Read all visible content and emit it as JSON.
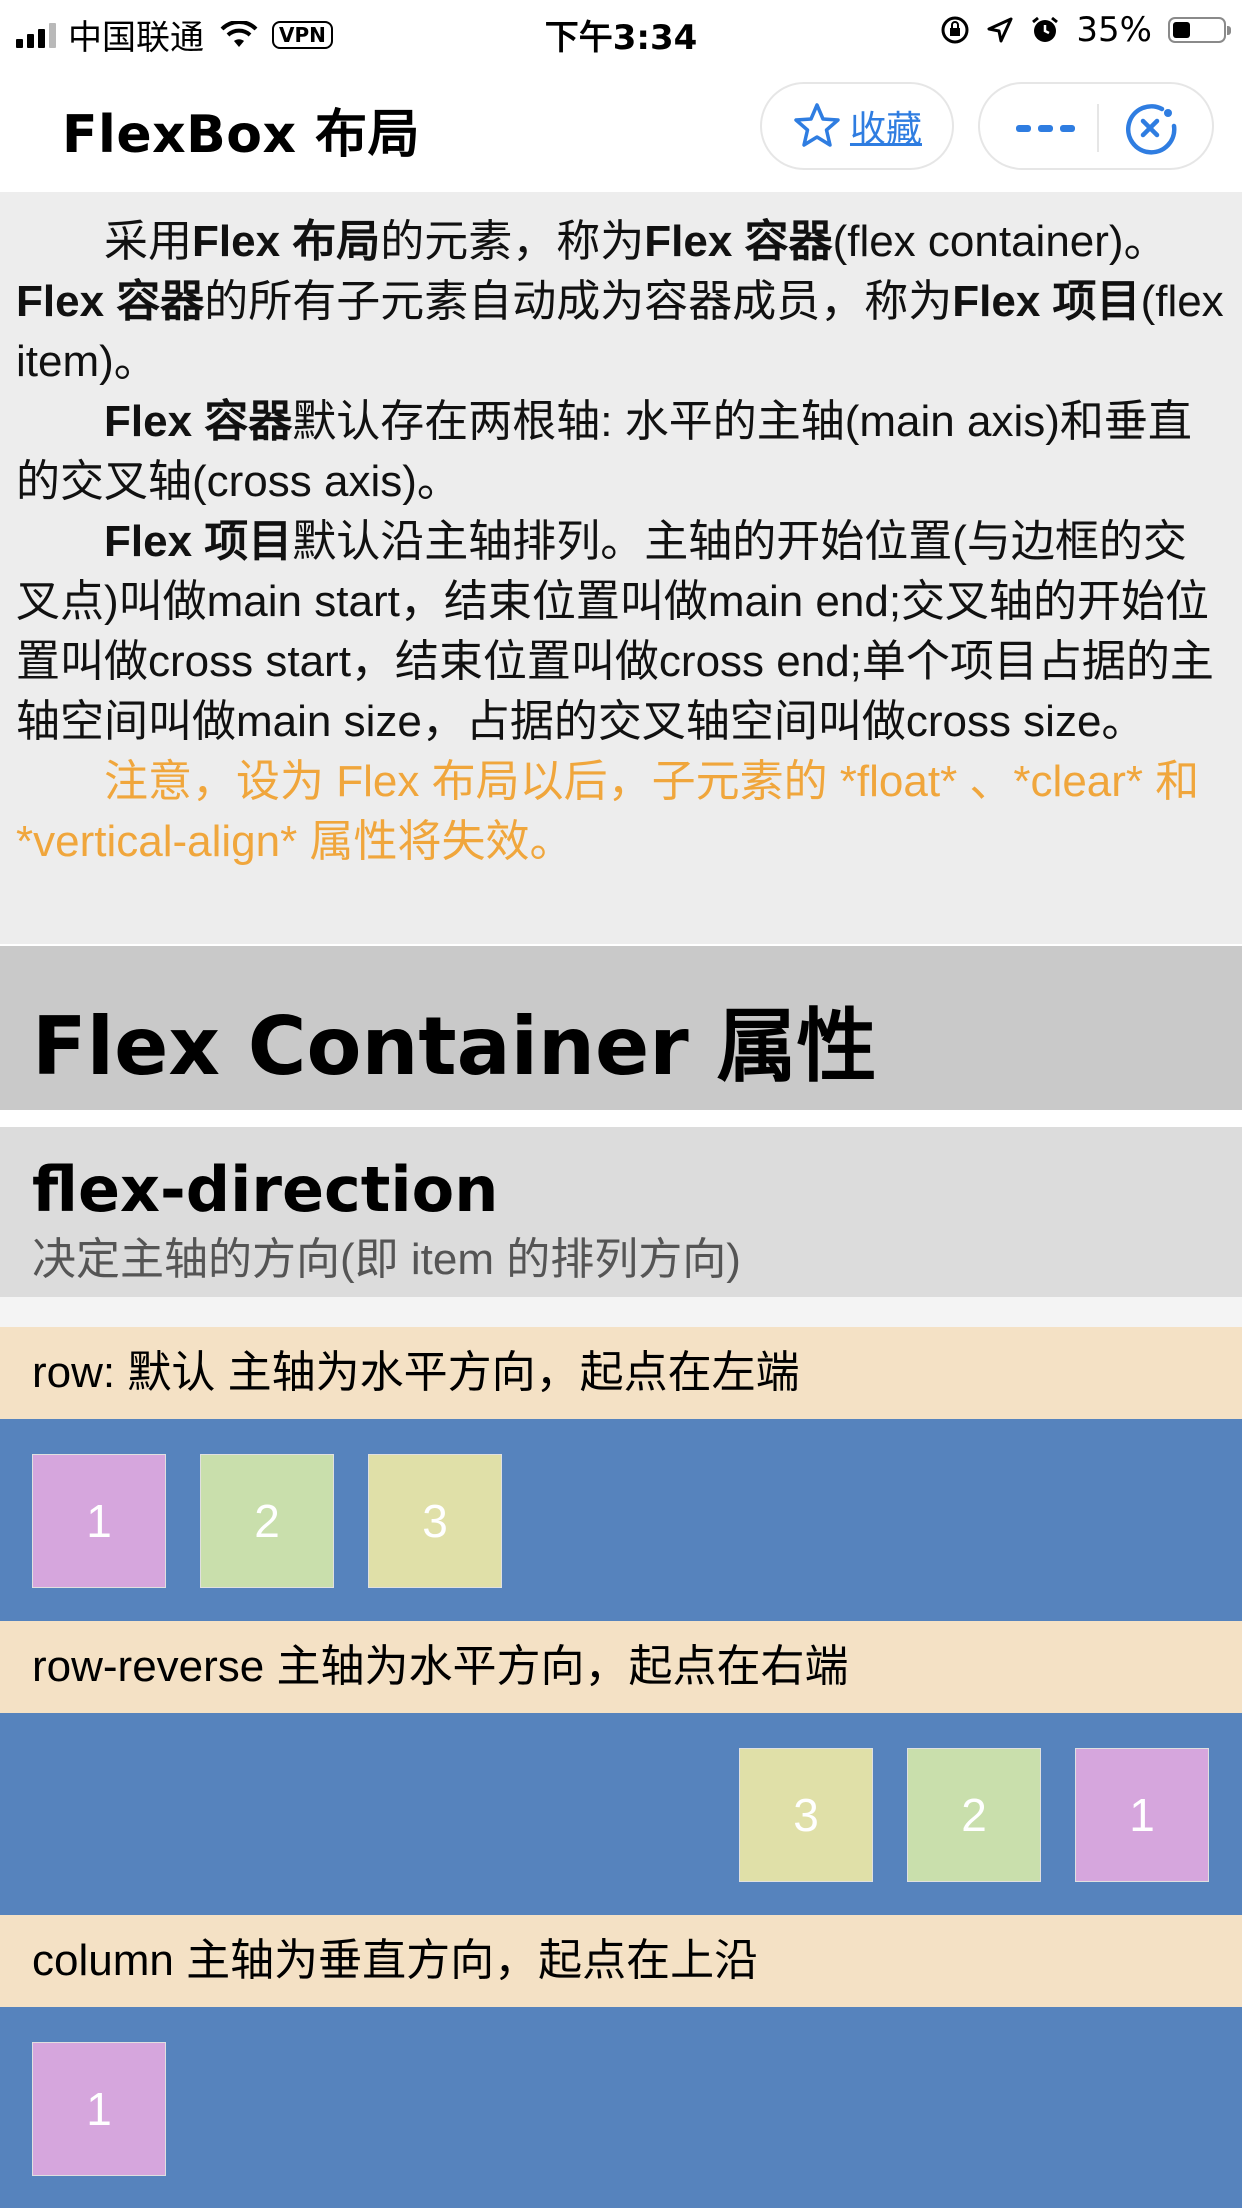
{
  "status_bar": {
    "carrier": "中国联通",
    "vpn": "VPN",
    "time": "下午3:34",
    "battery": "35%",
    "battery_level": 0.35
  },
  "nav": {
    "title": "FlexBox 布局",
    "favorite_label": "收藏"
  },
  "intro": {
    "p1": [
      "采用",
      "Flex 布局",
      "的元素，称为",
      "Flex 容器",
      "(flex container)。",
      "Flex 容器",
      "的所有子元素自动成为容器成员，称为",
      "Flex 项目",
      "(flex item)。"
    ],
    "p2": [
      "Flex 容器",
      "默认存在两根轴: 水平的主轴(main axis)和垂直的交叉轴(cross axis)。"
    ],
    "p3": [
      "Flex 项目",
      "默认沿主轴排列。主轴的开始位置(与边框的交叉点)叫做main start，结束位置叫做main end;交叉轴的开始位置叫做cross start，结束位置叫做cross end;单个项目占据的主轴空间叫做main size，占据的交叉轴空间叫做cross size。"
    ],
    "warning": "注意，设为 Flex 布局以后，子元素的 *float* 、*clear* 和 *vertical-align* 属性将失效。"
  },
  "section_title": "Flex Container 属性",
  "property": {
    "name": "flex-direction",
    "description": "决定主轴的方向(即 item 的排列方向)"
  },
  "demos": [
    {
      "label": "row: 默认 主轴为水平方向，起点在左端",
      "items": [
        "1",
        "2",
        "3"
      ]
    },
    {
      "label": "row-reverse 主轴为水平方向，起点在右端",
      "items": [
        "3",
        "2",
        "1"
      ]
    },
    {
      "label": "column 主轴为垂直方向，起点在上沿",
      "items": [
        "1"
      ]
    }
  ],
  "colors": {
    "item1": "#d6a6dd",
    "item2": "#c9dfac",
    "item3": "#e0e0a8",
    "container": "#5683bd",
    "label_bg": "#f4e1c5",
    "warning": "#f0a63c",
    "link": "#2f7de1"
  },
  "icons": [
    "signal-icon",
    "wifi-icon",
    "orientation-lock-icon",
    "location-arrow-icon",
    "alarm-icon",
    "battery-icon",
    "star-icon",
    "more-icon",
    "close-circle-icon"
  ]
}
